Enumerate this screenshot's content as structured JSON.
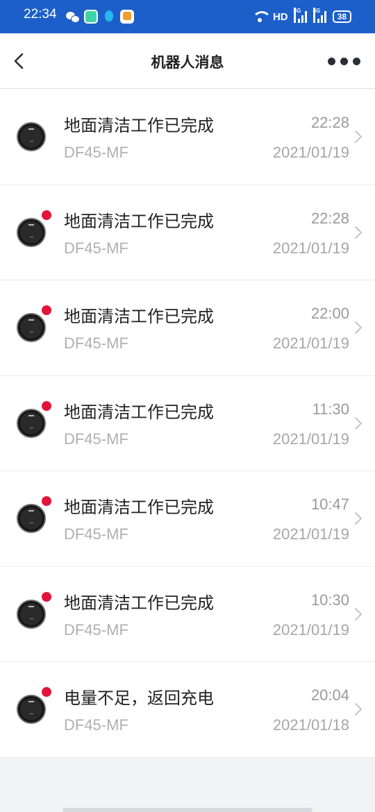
{
  "status_bar": {
    "time": "22:34",
    "network": "HD",
    "signal1_label": "4G",
    "signal2_label": "4G",
    "battery": "38",
    "icons": [
      "wechat-icon",
      "app-icon",
      "qq-icon",
      "app-icon",
      "wifi-icon",
      "signal-icon",
      "battery-icon"
    ]
  },
  "header": {
    "title": "机器人消息",
    "back_icon": "chevron-left-icon",
    "more_icon": "more-dots-icon"
  },
  "messages": [
    {
      "title": "地面清洁工作已完成",
      "time": "22:28",
      "device": "DF45-MF",
      "date": "2021/01/19",
      "unread": false
    },
    {
      "title": "地面清洁工作已完成",
      "time": "22:28",
      "device": "DF45-MF",
      "date": "2021/01/19",
      "unread": true
    },
    {
      "title": "地面清洁工作已完成",
      "time": "22:00",
      "device": "DF45-MF",
      "date": "2021/01/19",
      "unread": true
    },
    {
      "title": "地面清洁工作已完成",
      "time": "11:30",
      "device": "DF45-MF",
      "date": "2021/01/19",
      "unread": true
    },
    {
      "title": "地面清洁工作已完成",
      "time": "10:47",
      "device": "DF45-MF",
      "date": "2021/01/19",
      "unread": true
    },
    {
      "title": "地面清洁工作已完成",
      "time": "10:30",
      "device": "DF45-MF",
      "date": "2021/01/19",
      "unread": true
    },
    {
      "title": "电量不足，返回充电",
      "time": "20:04",
      "device": "DF45-MF",
      "date": "2021/01/18",
      "unread": true
    }
  ],
  "colors": {
    "status_bar": "#1d5fc9",
    "unread_dot": "#e2143a",
    "background": "#f2f3f5"
  }
}
